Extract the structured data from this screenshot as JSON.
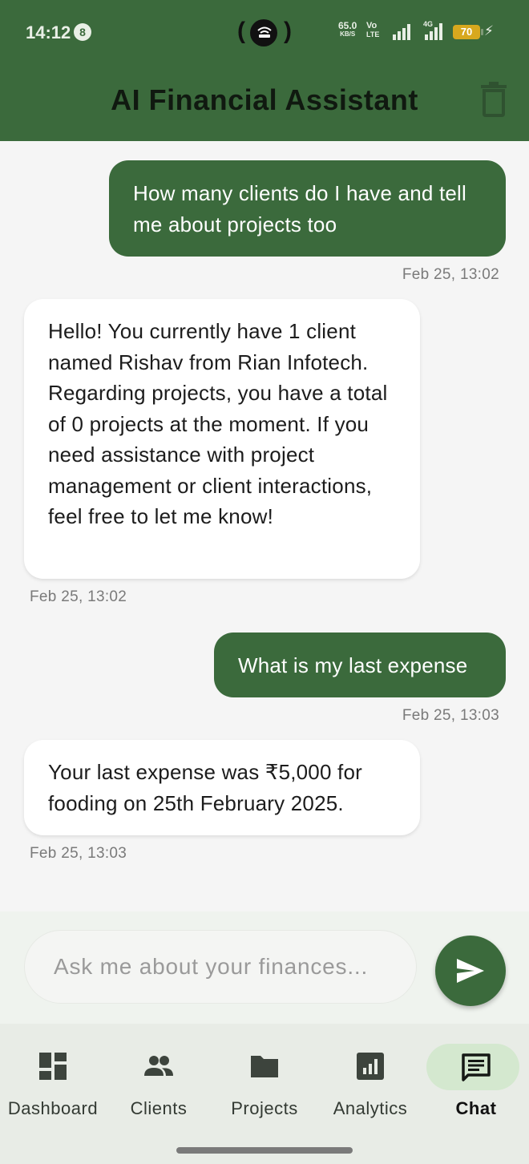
{
  "status_bar": {
    "time": "14:12",
    "notification_count": "8",
    "net_speed_value": "65.0",
    "net_speed_unit": "KB/S",
    "volte_top": "Vo",
    "volte_bottom": "LTE",
    "network_type": "4G",
    "battery": "70",
    "colors": {
      "battery": "#d7a81e"
    }
  },
  "app_bar": {
    "title": "AI Financial Assistant",
    "clear_icon": "trash-icon"
  },
  "messages": [
    {
      "role": "user",
      "text": "How many clients do I have and tell me about projects too",
      "time": "Feb 25, 13:02"
    },
    {
      "role": "assistant",
      "text": "Hello! You currently have 1 client named Rishav from Rian Infotech. Regarding projects, you have a total of 0 projects at the moment. If you need assistance with project management or client interactions, feel free to let me know!",
      "time": "Feb 25, 13:02"
    },
    {
      "role": "user",
      "text": "What is my last expense",
      "time": "Feb 25, 13:03"
    },
    {
      "role": "assistant",
      "text": "Your last expense was ₹5,000 for fooding on 25th February 2025.",
      "time": "Feb 25, 13:03"
    }
  ],
  "composer": {
    "value": "",
    "placeholder": "Ask me about your finances...",
    "send_icon": "send-icon"
  },
  "bottom_nav": {
    "active": "Chat",
    "items": [
      {
        "label": "Dashboard",
        "icon": "dashboard-icon"
      },
      {
        "label": "Clients",
        "icon": "people-icon"
      },
      {
        "label": "Projects",
        "icon": "folder-icon"
      },
      {
        "label": "Analytics",
        "icon": "analytics-icon"
      },
      {
        "label": "Chat",
        "icon": "chat-icon"
      }
    ]
  },
  "colors": {
    "primary": "#3b6a3c",
    "nav_active_pill": "#d4e8cf",
    "background": "#f5f5f5"
  }
}
